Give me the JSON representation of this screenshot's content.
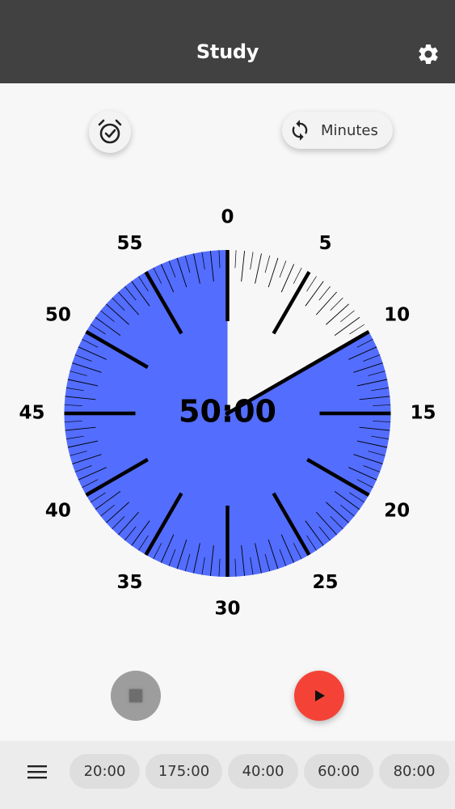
{
  "app_bar": {
    "title": "Study",
    "settings_icon": "gear-icon",
    "background": "#414141"
  },
  "toolbar": {
    "alarm_icon": "alarm-check-icon",
    "mode_label": "Minutes",
    "mode_icon": "sync-icon"
  },
  "dial": {
    "time_display": "50:00",
    "remaining_minutes": 50,
    "total_minutes": 60,
    "fill_color": "#536dfe",
    "labels": [
      "0",
      "55",
      "50",
      "45",
      "40",
      "35",
      "30",
      "25",
      "20",
      "15",
      "10",
      "5"
    ]
  },
  "controls": {
    "stop_icon": "stop-icon",
    "play_icon": "play-icon",
    "play_color": "#f44336"
  },
  "bottom_bar": {
    "menu_icon": "menu-icon",
    "presets": [
      "20:00",
      "175:00",
      "40:00",
      "60:00",
      "80:00"
    ]
  }
}
